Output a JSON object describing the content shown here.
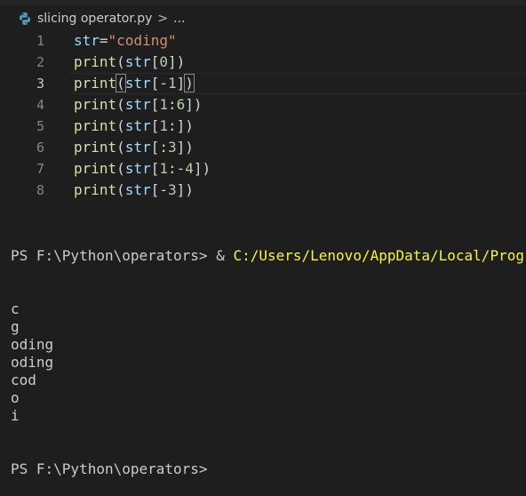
{
  "breadcrumb": {
    "file": "slicing operator.py",
    "separator": ">",
    "ellipsis": "...",
    "icon": "python-icon"
  },
  "editor": {
    "active_line": 3,
    "lines": [
      {
        "num": "1",
        "tokens": [
          {
            "t": "str",
            "c": "var"
          },
          {
            "t": "=",
            "c": "op"
          },
          {
            "t": "\"coding\"",
            "c": "str"
          }
        ]
      },
      {
        "num": "2",
        "tokens": [
          {
            "t": "print",
            "c": "func"
          },
          {
            "t": "(",
            "c": "punc"
          },
          {
            "t": "str",
            "c": "var"
          },
          {
            "t": "[",
            "c": "punc"
          },
          {
            "t": "0",
            "c": "num"
          },
          {
            "t": "])",
            "c": "punc"
          }
        ]
      },
      {
        "num": "3",
        "tokens": [
          {
            "t": "print",
            "c": "func"
          },
          {
            "t": "(",
            "c": "punc",
            "hl": true
          },
          {
            "t": "str",
            "c": "var"
          },
          {
            "t": "[",
            "c": "punc"
          },
          {
            "t": "-",
            "c": "op"
          },
          {
            "t": "1",
            "c": "num"
          },
          {
            "t": "]",
            "c": "punc"
          },
          {
            "t": ")",
            "c": "punc",
            "hl": true
          }
        ]
      },
      {
        "num": "4",
        "tokens": [
          {
            "t": "print",
            "c": "func"
          },
          {
            "t": "(",
            "c": "punc"
          },
          {
            "t": "str",
            "c": "var"
          },
          {
            "t": "[",
            "c": "punc"
          },
          {
            "t": "1",
            "c": "num"
          },
          {
            "t": ":",
            "c": "op"
          },
          {
            "t": "6",
            "c": "num"
          },
          {
            "t": "])",
            "c": "punc"
          }
        ]
      },
      {
        "num": "5",
        "tokens": [
          {
            "t": "print",
            "c": "func"
          },
          {
            "t": "(",
            "c": "punc"
          },
          {
            "t": "str",
            "c": "var"
          },
          {
            "t": "[",
            "c": "punc"
          },
          {
            "t": "1",
            "c": "num"
          },
          {
            "t": ":",
            "c": "op"
          },
          {
            "t": "])",
            "c": "punc"
          }
        ]
      },
      {
        "num": "6",
        "tokens": [
          {
            "t": "print",
            "c": "func"
          },
          {
            "t": "(",
            "c": "punc"
          },
          {
            "t": "str",
            "c": "var"
          },
          {
            "t": "[",
            "c": "punc"
          },
          {
            "t": ":",
            "c": "op"
          },
          {
            "t": "3",
            "c": "num"
          },
          {
            "t": "])",
            "c": "punc"
          }
        ]
      },
      {
        "num": "7",
        "tokens": [
          {
            "t": "print",
            "c": "func"
          },
          {
            "t": "(",
            "c": "punc"
          },
          {
            "t": "str",
            "c": "var"
          },
          {
            "t": "[",
            "c": "punc"
          },
          {
            "t": "1",
            "c": "num"
          },
          {
            "t": ":-",
            "c": "op"
          },
          {
            "t": "4",
            "c": "num"
          },
          {
            "t": "])",
            "c": "punc"
          }
        ]
      },
      {
        "num": "8",
        "tokens": [
          {
            "t": "print",
            "c": "func"
          },
          {
            "t": "(",
            "c": "punc"
          },
          {
            "t": "str",
            "c": "var"
          },
          {
            "t": "[",
            "c": "punc"
          },
          {
            "t": "-",
            "c": "op"
          },
          {
            "t": "3",
            "c": "num"
          },
          {
            "t": "])",
            "c": "punc"
          }
        ]
      }
    ]
  },
  "terminal": {
    "prompt": "PS F:\\Python\\operators> ",
    "amp": "& ",
    "command_path": "C:/Users/Lenovo/AppData/Local/Programs/",
    "output": [
      "c",
      "g",
      "oding",
      "oding",
      "cod",
      "o",
      "i"
    ],
    "final_prompt": "PS F:\\Python\\operators>"
  },
  "colors": {
    "background": "#1e1e1e",
    "function": "#dcdcaa",
    "variable": "#9cdcfe",
    "string": "#ce9178",
    "number": "#b5cea8",
    "terminal_path": "#f5f543"
  }
}
